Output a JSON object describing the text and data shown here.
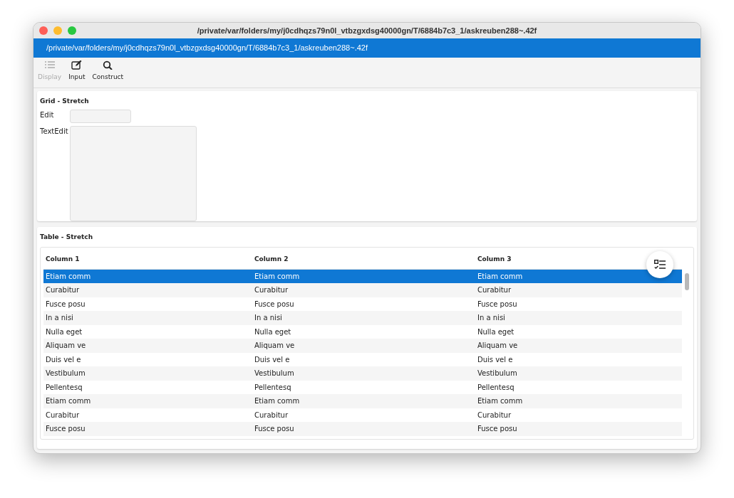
{
  "window": {
    "title": "/private/var/folders/my/j0cdhqzs79n0l_vtbzgxdsg40000gn/T/6884b7c3_1/askreuben288~.42f"
  },
  "path_bar": "/private/var/folders/my/j0cdhqzs79n0l_vtbzgxdsg40000gn/T/6884b7c3_1/askreuben288~.42f",
  "toolbar": [
    {
      "kind": "list",
      "label": "Display",
      "disabled": true
    },
    {
      "kind": "edit",
      "label": "Input",
      "disabled": false
    },
    {
      "kind": "search",
      "label": "Construct",
      "disabled": false
    }
  ],
  "grid_section": {
    "title": "Grid - Stretch",
    "fields": [
      {
        "kind": "line",
        "label": "Edit"
      },
      {
        "kind": "multiline",
        "label": "TextEdit"
      }
    ]
  },
  "table_section": {
    "title": "Table - Stretch",
    "columns": [
      "Column 1",
      "Column 2",
      "Column 3"
    ],
    "rows": [
      {
        "cells": [
          "Etiam comm",
          "Etiam comm",
          "Etiam comm"
        ],
        "selected": true
      },
      {
        "cells": [
          "Curabitur",
          "Curabitur",
          "Curabitur"
        ],
        "selected": false
      },
      {
        "cells": [
          "Fusce posu",
          "Fusce posu",
          "Fusce posu"
        ],
        "selected": false
      },
      {
        "cells": [
          "In a nisi",
          "In a nisi",
          "In a nisi"
        ],
        "selected": false
      },
      {
        "cells": [
          "Nulla eget",
          "Nulla eget",
          "Nulla eget"
        ],
        "selected": false
      },
      {
        "cells": [
          "Aliquam ve",
          "Aliquam ve",
          "Aliquam ve"
        ],
        "selected": false
      },
      {
        "cells": [
          "Duis vel e",
          "Duis vel e",
          "Duis vel e"
        ],
        "selected": false
      },
      {
        "cells": [
          "Vestibulum",
          "Vestibulum",
          "Vestibulum"
        ],
        "selected": false
      },
      {
        "cells": [
          "Pellentesq",
          "Pellentesq",
          "Pellentesq"
        ],
        "selected": false
      },
      {
        "cells": [
          "Etiam comm",
          "Etiam comm",
          "Etiam comm"
        ],
        "selected": false
      },
      {
        "cells": [
          "Curabitur",
          "Curabitur",
          "Curabitur"
        ],
        "selected": false
      },
      {
        "cells": [
          "Fusce posu",
          "Fusce posu",
          "Fusce posu"
        ],
        "selected": false
      }
    ]
  }
}
